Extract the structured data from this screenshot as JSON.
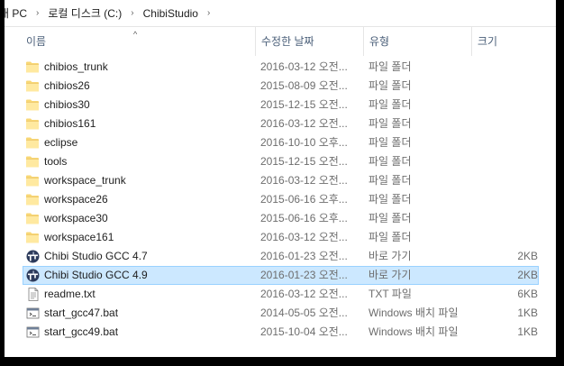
{
  "breadcrumb": {
    "items": [
      "내 PC",
      "로컬 디스크 (C:)",
      "ChibiStudio"
    ],
    "separator": "›"
  },
  "columns": {
    "name": "이름",
    "date": "수정한 날짜",
    "type": "유형",
    "size": "크기"
  },
  "sort_indicator": "^",
  "colors": {
    "selected_bg": "#cce8ff",
    "selected_border": "#99d1ff",
    "folder": "#ffd96a",
    "header_text": "#4c607a"
  },
  "files": [
    {
      "name": "chibios_trunk",
      "date": "2016-03-12 오전...",
      "type": "파일 폴더",
      "size": "",
      "icon": "folder-icon"
    },
    {
      "name": "chibios26",
      "date": "2015-08-09 오전...",
      "type": "파일 폴더",
      "size": "",
      "icon": "folder-icon"
    },
    {
      "name": "chibios30",
      "date": "2015-12-15 오전...",
      "type": "파일 폴더",
      "size": "",
      "icon": "folder-icon"
    },
    {
      "name": "chibios161",
      "date": "2016-03-12 오전...",
      "type": "파일 폴더",
      "size": "",
      "icon": "folder-icon"
    },
    {
      "name": "eclipse",
      "date": "2016-10-10 오후...",
      "type": "파일 폴더",
      "size": "",
      "icon": "folder-icon"
    },
    {
      "name": "tools",
      "date": "2015-12-15 오전...",
      "type": "파일 폴더",
      "size": "",
      "icon": "folder-icon"
    },
    {
      "name": "workspace_trunk",
      "date": "2016-03-12 오전...",
      "type": "파일 폴더",
      "size": "",
      "icon": "folder-icon"
    },
    {
      "name": "workspace26",
      "date": "2015-06-16 오후...",
      "type": "파일 폴더",
      "size": "",
      "icon": "folder-icon"
    },
    {
      "name": "workspace30",
      "date": "2015-06-16 오후...",
      "type": "파일 폴더",
      "size": "",
      "icon": "folder-icon"
    },
    {
      "name": "workspace161",
      "date": "2016-03-12 오전...",
      "type": "파일 폴더",
      "size": "",
      "icon": "folder-icon"
    },
    {
      "name": "Chibi Studio GCC 4.7",
      "date": "2016-01-23 오전...",
      "type": "바로 가기",
      "size": "2KB",
      "icon": "shortcut-icon"
    },
    {
      "name": "Chibi Studio GCC 4.9",
      "date": "2016-01-23 오전...",
      "type": "바로 가기",
      "size": "2KB",
      "icon": "shortcut-icon",
      "selected": true
    },
    {
      "name": "readme.txt",
      "date": "2016-03-12 오전...",
      "type": "TXT 파일",
      "size": "6KB",
      "icon": "text-file-icon"
    },
    {
      "name": "start_gcc47.bat",
      "date": "2014-05-05 오전...",
      "type": "Windows 배치 파일",
      "size": "1KB",
      "icon": "batch-file-icon"
    },
    {
      "name": "start_gcc49.bat",
      "date": "2015-10-04 오전...",
      "type": "Windows 배치 파일",
      "size": "1KB",
      "icon": "batch-file-icon"
    }
  ]
}
